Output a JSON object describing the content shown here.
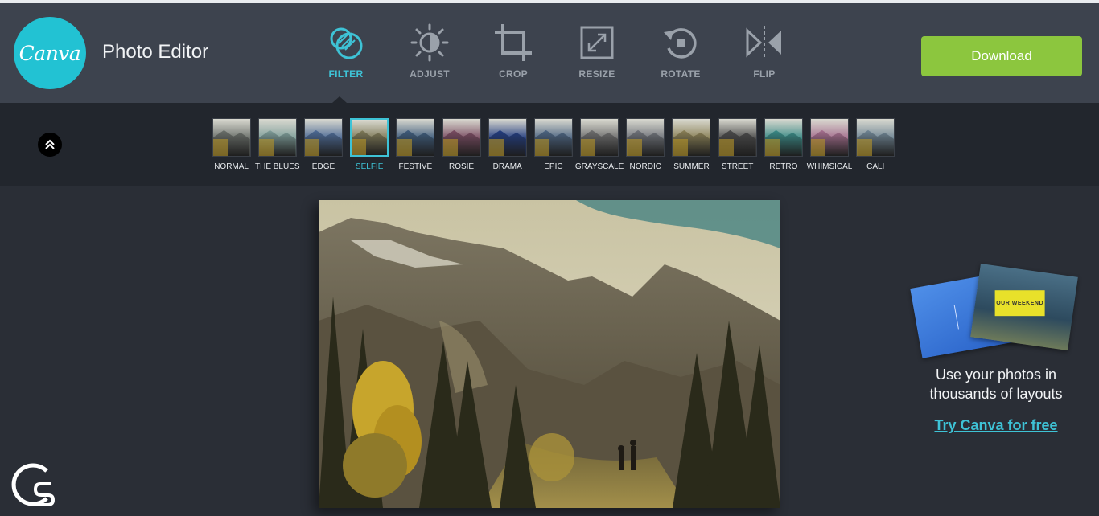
{
  "header": {
    "logo_text": "Canva",
    "app_title": "Photo Editor",
    "download_label": "Download"
  },
  "tools": [
    {
      "label": "FILTER",
      "icon": "filter-icon",
      "active": true
    },
    {
      "label": "ADJUST",
      "icon": "adjust-icon",
      "active": false
    },
    {
      "label": "CROP",
      "icon": "crop-icon",
      "active": false
    },
    {
      "label": "RESIZE",
      "icon": "resize-icon",
      "active": false
    },
    {
      "label": "ROTATE",
      "icon": "rotate-icon",
      "active": false
    },
    {
      "label": "FLIP",
      "icon": "flip-icon",
      "active": false
    }
  ],
  "filters": [
    {
      "name": "NORMAL",
      "tint": "#6a6f6a"
    },
    {
      "name": "THE BLUES",
      "tint": "#7f9e9a"
    },
    {
      "name": "EDGE",
      "tint": "#4d6a95"
    },
    {
      "name": "SELFIE",
      "tint": "#7f7a58",
      "selected": true
    },
    {
      "name": "FESTIVE",
      "tint": "#3f5c7c"
    },
    {
      "name": "ROSIE",
      "tint": "#7a4c62"
    },
    {
      "name": "DRAMA",
      "tint": "#233d80"
    },
    {
      "name": "EPIC",
      "tint": "#4d6582"
    },
    {
      "name": "GRAYSCALE",
      "tint": "#6e6e6e"
    },
    {
      "name": "NORDIC",
      "tint": "#6f737a"
    },
    {
      "name": "SUMMER",
      "tint": "#8a8056"
    },
    {
      "name": "STREET",
      "tint": "#4b4b4b"
    },
    {
      "name": "RETRO",
      "tint": "#3a8a86"
    },
    {
      "name": "WHIMSICAL",
      "tint": "#a56e8e"
    },
    {
      "name": "CALI",
      "tint": "#6f8594"
    }
  ],
  "promo": {
    "text_line1": "Use your photos in",
    "text_line2": "thousands of layouts",
    "link": "Try Canva for free",
    "card_badge": "OUR WEEKEND"
  },
  "colors": {
    "accent": "#3ec3d6",
    "download": "#8cc63e",
    "header_bg": "#3d434e",
    "filterbar_bg": "#22262d"
  }
}
